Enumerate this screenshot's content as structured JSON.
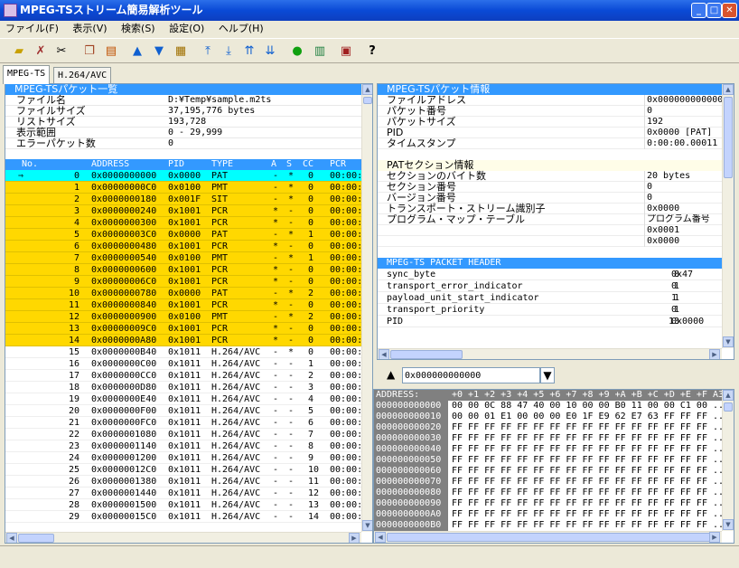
{
  "window": {
    "title": "MPEG-TSストリーム簡易解析ツール"
  },
  "menu": [
    "ファイル(F)",
    "表示(V)",
    "検索(S)",
    "設定(O)",
    "ヘルプ(H)"
  ],
  "toolbar_icons": [
    "open-folder-icon",
    "delete-icon",
    "cut-icon",
    "copy-icon",
    "table-icon",
    "up-arrow-icon",
    "down-arrow-icon",
    "filter-icon",
    "first-icon",
    "last-icon",
    "prev-mark-icon",
    "next-mark-icon",
    "go-icon",
    "list-icon",
    "settings-icon",
    "help-icon"
  ],
  "tabs": [
    "MPEG-TS",
    "H.264/AVC"
  ],
  "packet_list": {
    "title": "MPEG-TSパケット一覧",
    "info": [
      {
        "label": "ファイル名",
        "value": "D:¥Temp¥sample.m2ts"
      },
      {
        "label": "ファイルサイズ",
        "value": "37,195,776 bytes"
      },
      {
        "label": "リストサイズ",
        "value": "193,728"
      },
      {
        "label": "表示範囲",
        "value": "0 - 29,999"
      },
      {
        "label": "エラーパケット数",
        "value": "0"
      }
    ],
    "columns": [
      "No.",
      "ADDRESS",
      "PID",
      "TYPE",
      "A",
      "S",
      "CC",
      "PCR"
    ],
    "rows": [
      {
        "marker": "⇒",
        "no": "0",
        "address": "0x0000000000",
        "pid": "0x0000",
        "type": "PAT",
        "a": "-",
        "s": "*",
        "cc": "0",
        "pcr": "00:00:",
        "style": "cursor"
      },
      {
        "marker": "",
        "no": "1",
        "address": "0x00000000C0",
        "pid": "0x0100",
        "type": "PMT",
        "a": "-",
        "s": "*",
        "cc": "0",
        "pcr": "00:00:",
        "style": "hl"
      },
      {
        "marker": "",
        "no": "2",
        "address": "0x0000000180",
        "pid": "0x001F",
        "type": "SIT",
        "a": "-",
        "s": "*",
        "cc": "0",
        "pcr": "00:00:",
        "style": "hl"
      },
      {
        "marker": "",
        "no": "3",
        "address": "0x0000000240",
        "pid": "0x1001",
        "type": "PCR",
        "a": "*",
        "s": "-",
        "cc": "0",
        "pcr": "00:00:",
        "style": "hl"
      },
      {
        "marker": "",
        "no": "4",
        "address": "0x0000000300",
        "pid": "0x1001",
        "type": "PCR",
        "a": "*",
        "s": "-",
        "cc": "0",
        "pcr": "00:00:",
        "style": "hl"
      },
      {
        "marker": "",
        "no": "5",
        "address": "0x00000003C0",
        "pid": "0x0000",
        "type": "PAT",
        "a": "-",
        "s": "*",
        "cc": "1",
        "pcr": "00:00:",
        "style": "hl"
      },
      {
        "marker": "",
        "no": "6",
        "address": "0x0000000480",
        "pid": "0x1001",
        "type": "PCR",
        "a": "*",
        "s": "-",
        "cc": "0",
        "pcr": "00:00:",
        "style": "hl"
      },
      {
        "marker": "",
        "no": "7",
        "address": "0x0000000540",
        "pid": "0x0100",
        "type": "PMT",
        "a": "-",
        "s": "*",
        "cc": "1",
        "pcr": "00:00:",
        "style": "hl"
      },
      {
        "marker": "",
        "no": "8",
        "address": "0x0000000600",
        "pid": "0x1001",
        "type": "PCR",
        "a": "*",
        "s": "-",
        "cc": "0",
        "pcr": "00:00:",
        "style": "hl"
      },
      {
        "marker": "",
        "no": "9",
        "address": "0x00000006C0",
        "pid": "0x1001",
        "type": "PCR",
        "a": "*",
        "s": "-",
        "cc": "0",
        "pcr": "00:00:",
        "style": "hl"
      },
      {
        "marker": "",
        "no": "10",
        "address": "0x0000000780",
        "pid": "0x0000",
        "type": "PAT",
        "a": "-",
        "s": "*",
        "cc": "2",
        "pcr": "00:00:",
        "style": "hl"
      },
      {
        "marker": "",
        "no": "11",
        "address": "0x0000000840",
        "pid": "0x1001",
        "type": "PCR",
        "a": "*",
        "s": "-",
        "cc": "0",
        "pcr": "00:00:",
        "style": "hl"
      },
      {
        "marker": "",
        "no": "12",
        "address": "0x0000000900",
        "pid": "0x0100",
        "type": "PMT",
        "a": "-",
        "s": "*",
        "cc": "2",
        "pcr": "00:00:",
        "style": "hl"
      },
      {
        "marker": "",
        "no": "13",
        "address": "0x00000009C0",
        "pid": "0x1001",
        "type": "PCR",
        "a": "*",
        "s": "-",
        "cc": "0",
        "pcr": "00:00:",
        "style": "hl"
      },
      {
        "marker": "",
        "no": "14",
        "address": "0x0000000A80",
        "pid": "0x1001",
        "type": "PCR",
        "a": "*",
        "s": "-",
        "cc": "0",
        "pcr": "00:00:",
        "style": "hl"
      },
      {
        "marker": "",
        "no": "15",
        "address": "0x0000000B40",
        "pid": "0x1011",
        "type": "H.264/AVC",
        "a": "-",
        "s": "*",
        "cc": "0",
        "pcr": "00:00:",
        "style": ""
      },
      {
        "marker": "",
        "no": "16",
        "address": "0x0000000C00",
        "pid": "0x1011",
        "type": "H.264/AVC",
        "a": "-",
        "s": "-",
        "cc": "1",
        "pcr": "00:00:",
        "style": ""
      },
      {
        "marker": "",
        "no": "17",
        "address": "0x0000000CC0",
        "pid": "0x1011",
        "type": "H.264/AVC",
        "a": "-",
        "s": "-",
        "cc": "2",
        "pcr": "00:00:",
        "style": ""
      },
      {
        "marker": "",
        "no": "18",
        "address": "0x0000000D80",
        "pid": "0x1011",
        "type": "H.264/AVC",
        "a": "-",
        "s": "-",
        "cc": "3",
        "pcr": "00:00:",
        "style": ""
      },
      {
        "marker": "",
        "no": "19",
        "address": "0x0000000E40",
        "pid": "0x1011",
        "type": "H.264/AVC",
        "a": "-",
        "s": "-",
        "cc": "4",
        "pcr": "00:00:",
        "style": ""
      },
      {
        "marker": "",
        "no": "20",
        "address": "0x0000000F00",
        "pid": "0x1011",
        "type": "H.264/AVC",
        "a": "-",
        "s": "-",
        "cc": "5",
        "pcr": "00:00:",
        "style": ""
      },
      {
        "marker": "",
        "no": "21",
        "address": "0x0000000FC0",
        "pid": "0x1011",
        "type": "H.264/AVC",
        "a": "-",
        "s": "-",
        "cc": "6",
        "pcr": "00:00:",
        "style": ""
      },
      {
        "marker": "",
        "no": "22",
        "address": "0x0000001080",
        "pid": "0x1011",
        "type": "H.264/AVC",
        "a": "-",
        "s": "-",
        "cc": "7",
        "pcr": "00:00:",
        "style": ""
      },
      {
        "marker": "",
        "no": "23",
        "address": "0x0000001140",
        "pid": "0x1011",
        "type": "H.264/AVC",
        "a": "-",
        "s": "-",
        "cc": "8",
        "pcr": "00:00:",
        "style": ""
      },
      {
        "marker": "",
        "no": "24",
        "address": "0x0000001200",
        "pid": "0x1011",
        "type": "H.264/AVC",
        "a": "-",
        "s": "-",
        "cc": "9",
        "pcr": "00:00:",
        "style": ""
      },
      {
        "marker": "",
        "no": "25",
        "address": "0x00000012C0",
        "pid": "0x1011",
        "type": "H.264/AVC",
        "a": "-",
        "s": "-",
        "cc": "10",
        "pcr": "00:00:",
        "style": ""
      },
      {
        "marker": "",
        "no": "26",
        "address": "0x0000001380",
        "pid": "0x1011",
        "type": "H.264/AVC",
        "a": "-",
        "s": "-",
        "cc": "11",
        "pcr": "00:00:",
        "style": ""
      },
      {
        "marker": "",
        "no": "27",
        "address": "0x0000001440",
        "pid": "0x1011",
        "type": "H.264/AVC",
        "a": "-",
        "s": "-",
        "cc": "12",
        "pcr": "00:00:",
        "style": ""
      },
      {
        "marker": "",
        "no": "28",
        "address": "0x0000001500",
        "pid": "0x1011",
        "type": "H.264/AVC",
        "a": "-",
        "s": "-",
        "cc": "13",
        "pcr": "00:00:",
        "style": ""
      },
      {
        "marker": "",
        "no": "29",
        "address": "0x00000015C0",
        "pid": "0x1011",
        "type": "H.264/AVC",
        "a": "-",
        "s": "-",
        "cc": "14",
        "pcr": "00:00:",
        "style": ""
      }
    ]
  },
  "packet_info": {
    "title": "MPEG-TSパケット情報",
    "rows": [
      {
        "label": "ファイルアドレス",
        "value": "0x000000000000"
      },
      {
        "label": "パケット番号",
        "value": "0"
      },
      {
        "label": "パケットサイズ",
        "value": "192"
      },
      {
        "label": "PID",
        "value": "0x0000 [PAT]"
      },
      {
        "label": "タイムスタンプ",
        "value": "0:00:00.00011"
      }
    ],
    "section_title": "PATセクション情報",
    "section_rows": [
      {
        "label": "セクションのバイト数",
        "value": "20 bytes"
      },
      {
        "label": "セクション番号",
        "value": "0"
      },
      {
        "label": "バージョン番号",
        "value": "0"
      },
      {
        "label": "トランスポート・ストリーム識別子",
        "value": "0x0000"
      },
      {
        "label": "プログラム・マップ・テーブル",
        "value": "プログラム番号"
      },
      {
        "label": "",
        "value": "0x0001"
      },
      {
        "label": "",
        "value": "0x0000"
      }
    ],
    "header_title": "MPEG-TS PACKET HEADER",
    "header_rows": [
      {
        "label": "sync_byte",
        "bits": "8",
        "value": "0x47"
      },
      {
        "label": "transport_error_indicator",
        "bits": "1",
        "value": "0"
      },
      {
        "label": "payload_unit_start_indicator",
        "bits": "1",
        "value": "1"
      },
      {
        "label": "transport_priority",
        "bits": "1",
        "value": "0"
      },
      {
        "label": "PID",
        "bits": "13",
        "value": "0x0000"
      }
    ]
  },
  "hex": {
    "address_input": "0x000000000000",
    "header": [
      "ADDRESS:",
      "+0 +1 +2 +3 +4 +5 +6 +7 +8 +9 +A +B +C +D +E +F A3"
    ],
    "rows": [
      {
        "addr": "000000000000",
        "bytes": "00 00 0C 88 47 40 00 10 00 00 B0 11 00 00 C1 00 .."
      },
      {
        "addr": "000000000010",
        "bytes": "00 00 01 E1 00 00 00 E0 1F E9 62 E7 63 FF FF FF .."
      },
      {
        "addr": "000000000020",
        "bytes": "FF FF FF FF FF FF FF FF FF FF FF FF FF FF FF FF .."
      },
      {
        "addr": "000000000030",
        "bytes": "FF FF FF FF FF FF FF FF FF FF FF FF FF FF FF FF .."
      },
      {
        "addr": "000000000040",
        "bytes": "FF FF FF FF FF FF FF FF FF FF FF FF FF FF FF FF .."
      },
      {
        "addr": "000000000050",
        "bytes": "FF FF FF FF FF FF FF FF FF FF FF FF FF FF FF FF .."
      },
      {
        "addr": "000000000060",
        "bytes": "FF FF FF FF FF FF FF FF FF FF FF FF FF FF FF FF .."
      },
      {
        "addr": "000000000070",
        "bytes": "FF FF FF FF FF FF FF FF FF FF FF FF FF FF FF FF .."
      },
      {
        "addr": "000000000080",
        "bytes": "FF FF FF FF FF FF FF FF FF FF FF FF FF FF FF FF .."
      },
      {
        "addr": "000000000090",
        "bytes": "FF FF FF FF FF FF FF FF FF FF FF FF FF FF FF FF .."
      },
      {
        "addr": "0000000000A0",
        "bytes": "FF FF FF FF FF FF FF FF FF FF FF FF FF FF FF FF .."
      },
      {
        "addr": "0000000000B0",
        "bytes": "FF FF FF FF FF FF FF FF FF FF FF FF FF FF FF FF .."
      }
    ]
  },
  "colors": {
    "title_blue": "#0a4ad6",
    "header_blue": "#3399ff",
    "highlight_yellow": "#ffd800",
    "cursor_cyan": "#00ffff",
    "hex_gray": "#808080"
  }
}
